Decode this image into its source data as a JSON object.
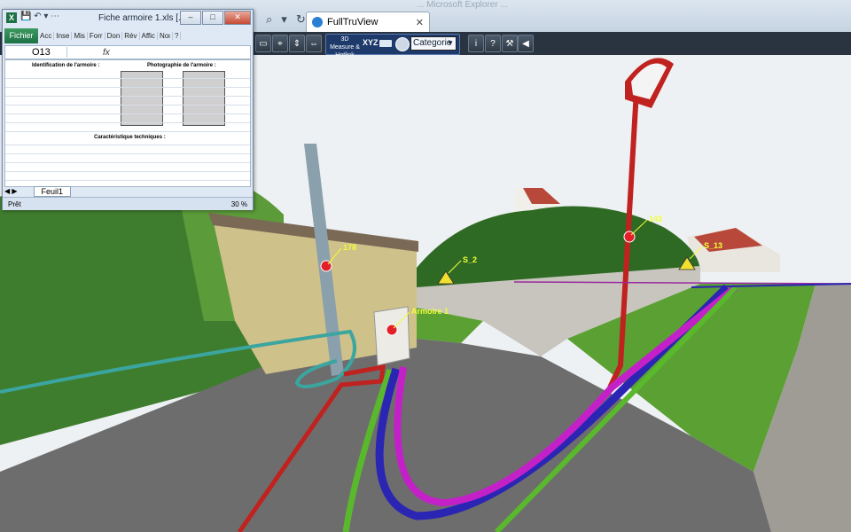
{
  "browser": {
    "faded_title": "... Microsoft Explorer ...",
    "tab_title": "FullTruView",
    "tab_close": "✕"
  },
  "toolbar": {
    "btn_3d_measure": "3D Measure & Hotlink",
    "btn_xyz": "XYZ",
    "category_value": "Categorie",
    "help_label": "?",
    "info_label": "i"
  },
  "scene": {
    "labels": {
      "pole": "178",
      "cabinet": "Armoire 1",
      "hedge_marker": "143",
      "sign_left": "S_2",
      "sign_right": "S_13"
    }
  },
  "excel": {
    "title": "Fiche armoire 1.xls [...",
    "logo": "X",
    "tabs": [
      "Fichier",
      "Acc",
      "Inse",
      "Mis",
      "Forr",
      "Don",
      "Rév",
      "Affic",
      "Noι"
    ],
    "cell_ref": "O13",
    "fx": "fx",
    "sheet_heading_left": "Identification de l'armoire :",
    "sheet_heading_right": "Photographie de l'armoire :",
    "sheet_subheading": "Caractéristique techniques :",
    "sheet_tab": "Feuil1",
    "status": "Prêt",
    "zoom": "30 %"
  }
}
